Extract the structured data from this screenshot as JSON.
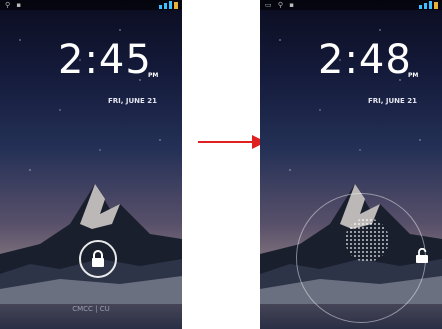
{
  "left_screen": {
    "time": "2:45",
    "ampm": "PM",
    "date": "FRI, JUNE 21",
    "carrier": "CMCC | CU"
  },
  "right_screen": {
    "time": "2:48",
    "ampm": "PM",
    "date": "FRI, JUNE 21"
  },
  "colors": {
    "arrow": "#e02020",
    "signal": "#3cc3ff",
    "battery": "#e8b23a"
  },
  "icons": {
    "lock": "lock-icon",
    "unlock": "unlock-icon",
    "arrow": "arrow-right-icon"
  }
}
